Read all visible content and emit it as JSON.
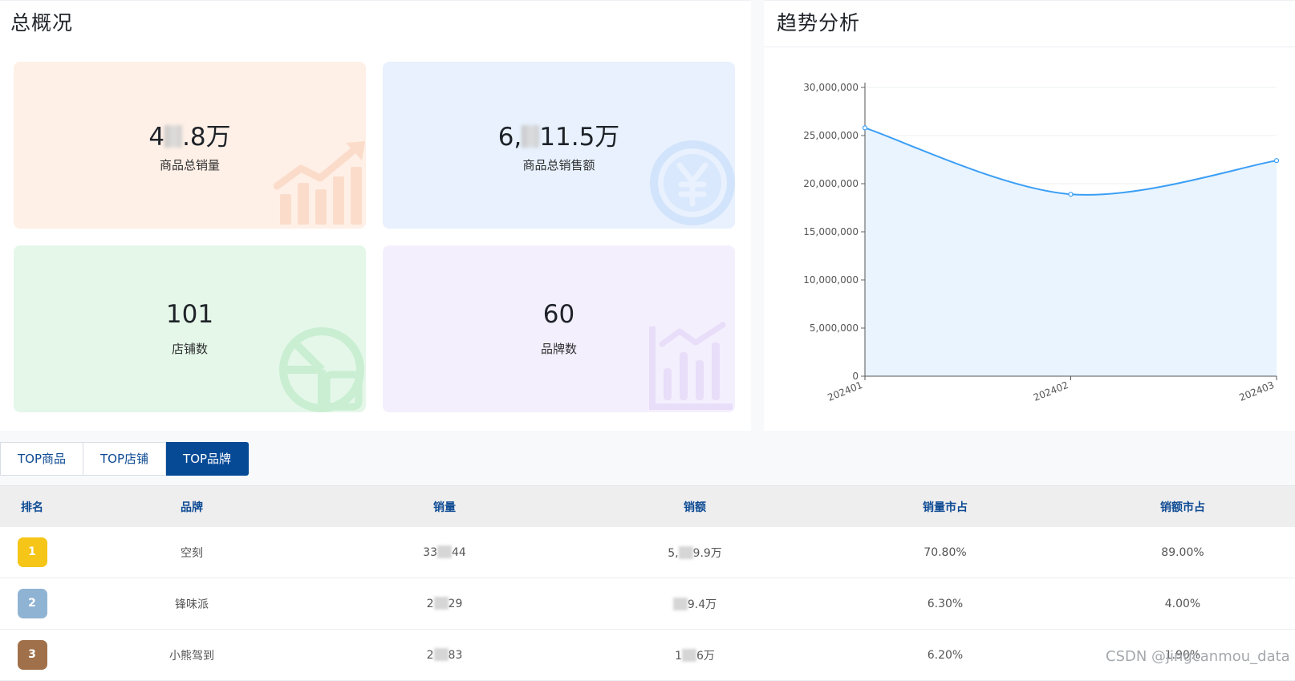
{
  "overview": {
    "title": "总概况",
    "cards": [
      {
        "value_pre": "4",
        "value_post": ".8万",
        "label": "商品总销量",
        "icon": "trend-up-icon",
        "color": "#fef0e7"
      },
      {
        "value_pre": "6,",
        "value_post": "11.5万",
        "label": "商品总销售额",
        "icon": "yen-coin-icon",
        "color": "#e8f1fd"
      },
      {
        "value": "101",
        "label": "店铺数",
        "icon": "pie-chart-icon",
        "color": "#e4f7e8"
      },
      {
        "value": "60",
        "label": "品牌数",
        "icon": "bar-chart-icon",
        "color": "#f4effd"
      }
    ]
  },
  "trend": {
    "title": "趋势分析",
    "chart_data": {
      "type": "line",
      "smooth": true,
      "area": true,
      "x": [
        "202401",
        "202402",
        "202403"
      ],
      "series": [
        {
          "values": [
            25800000,
            18900000,
            22400000
          ]
        }
      ],
      "ylim": [
        0,
        30000000
      ],
      "yticks": [
        "0",
        "5,000,000",
        "10,000,000",
        "15,000,000",
        "20,000,000",
        "25,000,000",
        "30,000,000"
      ],
      "ytick_values": [
        0,
        5000000,
        10000000,
        15000000,
        20000000,
        25000000,
        30000000
      ],
      "grid": true,
      "line_color": "#3b9ef5",
      "area_color": "#e9f4fe"
    }
  },
  "tabs": [
    {
      "label": "TOP商品",
      "active": false
    },
    {
      "label": "TOP店铺",
      "active": false
    },
    {
      "label": "TOP品牌",
      "active": true
    }
  ],
  "table": {
    "headers": {
      "rank": "排名",
      "brand": "品牌",
      "qty": "销量",
      "amount": "销额",
      "qty_share": "销量市占",
      "amount_share": "销额市占"
    },
    "rows": [
      {
        "rank": "1",
        "badge_color": "#f5c518",
        "brand": "空刻",
        "qty_pre": "33",
        "qty_post": "44",
        "amt_pre": "5,",
        "amt_post": "9.9万",
        "qty_share": "70.80%",
        "amount_share": "89.00%"
      },
      {
        "rank": "2",
        "badge_color": "#8fb3d3",
        "brand": "锋味派",
        "qty_pre": "2",
        "qty_post": "29",
        "amt_pre": "",
        "amt_post": "9.4万",
        "qty_share": "6.30%",
        "amount_share": "4.00%"
      },
      {
        "rank": "3",
        "badge_color": "#a0704a",
        "brand": "小熊驾到",
        "qty_pre": "2",
        "qty_post": "83",
        "amt_pre": "1",
        "amt_post": "6万",
        "qty_share": "6.20%",
        "amount_share": "1.90%"
      }
    ]
  },
  "watermark": "CSDN @jingcanmou_data"
}
